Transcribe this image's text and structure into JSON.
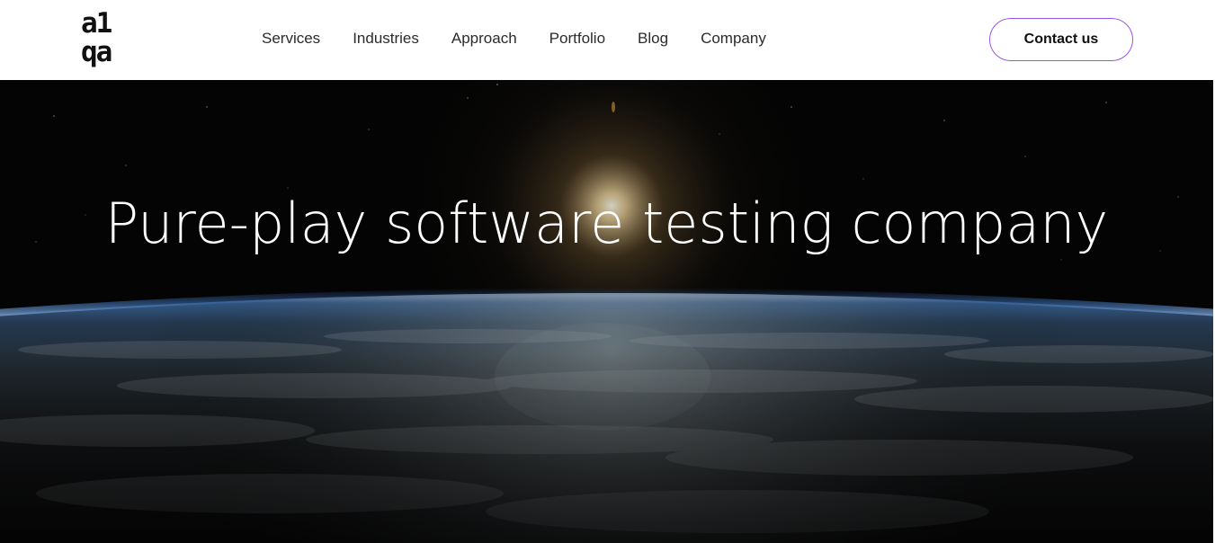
{
  "logo": {
    "line1": "a1",
    "line2": "qa"
  },
  "nav": {
    "items": [
      "Services",
      "Industries",
      "Approach",
      "Portfolio",
      "Blog",
      "Company"
    ]
  },
  "header": {
    "contact_label": "Contact us"
  },
  "hero": {
    "title": "Pure-play software testing company"
  },
  "colors": {
    "accent_border": "#9b55e8",
    "text_dark": "#111111",
    "hero_bg": "#050505"
  }
}
